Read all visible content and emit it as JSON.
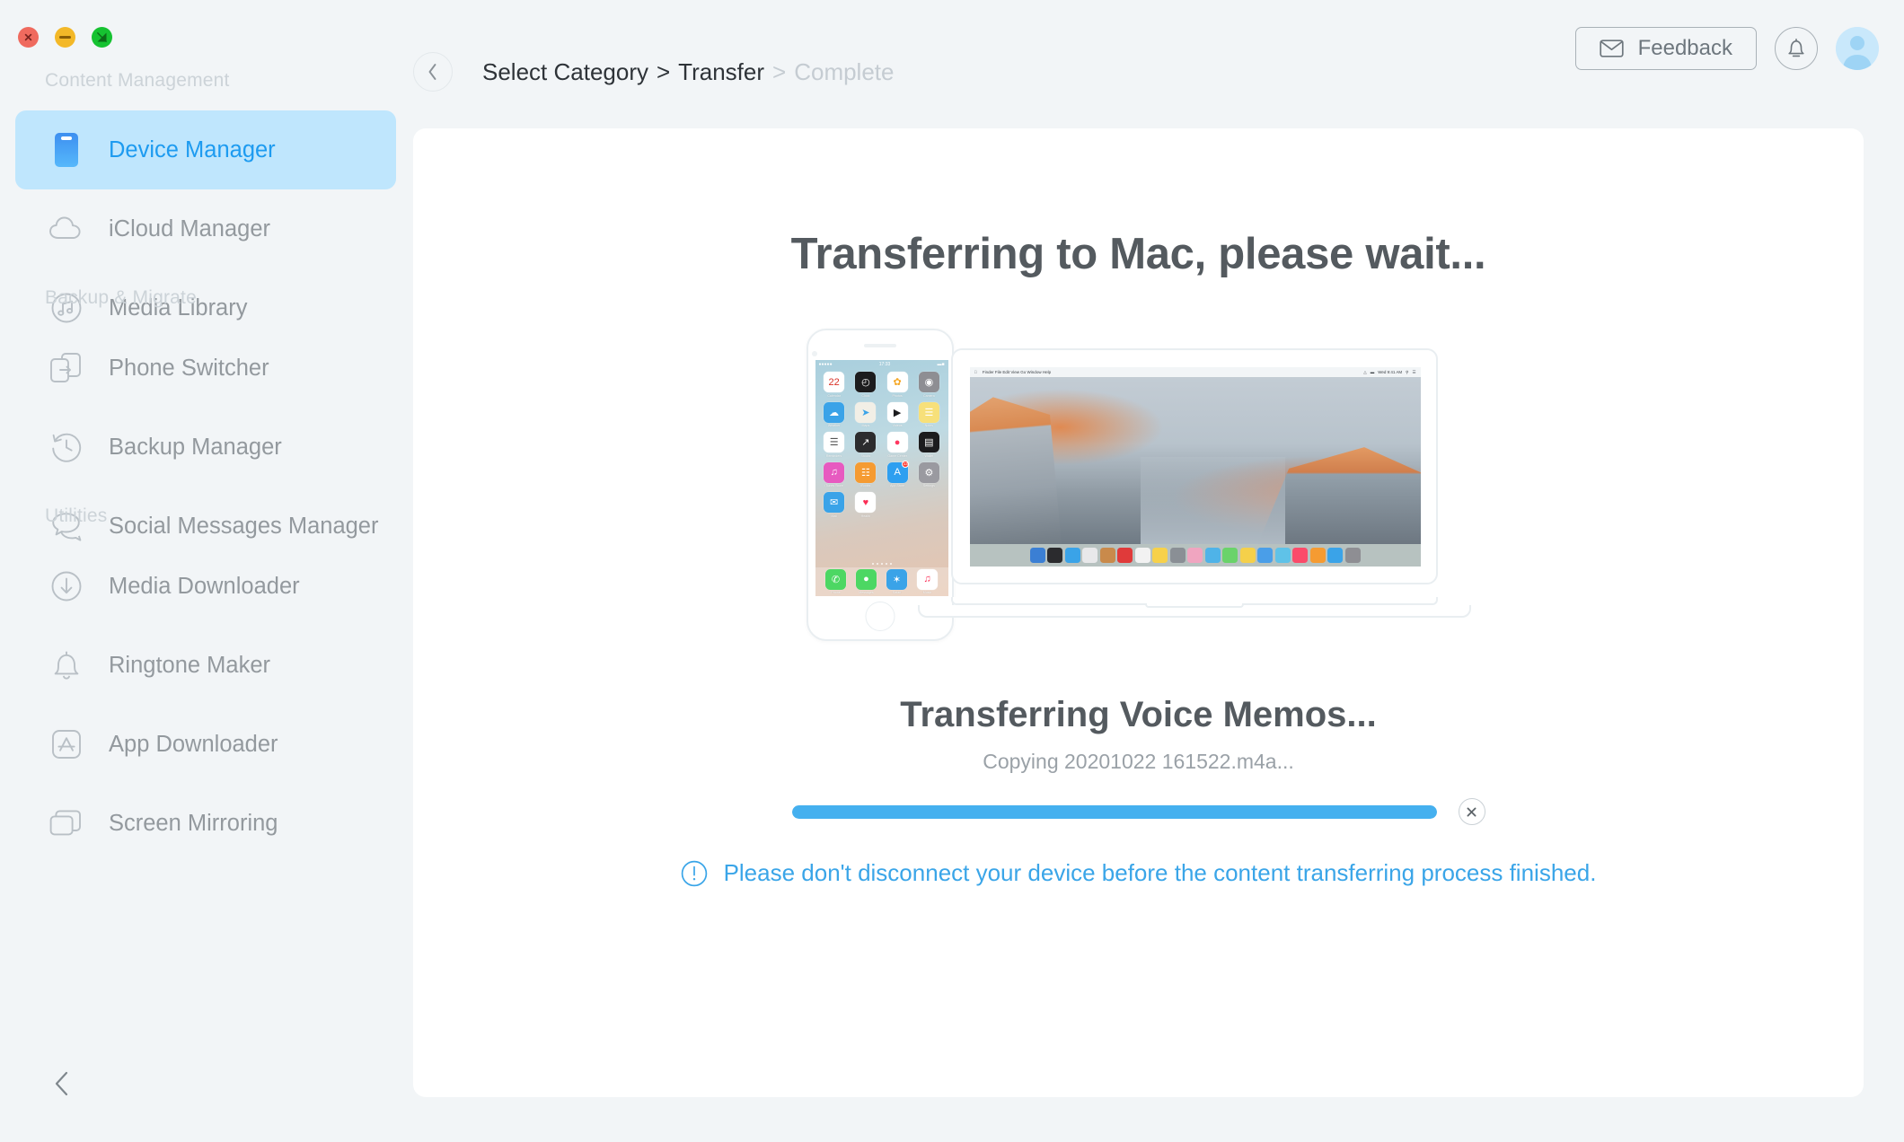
{
  "window": {
    "traffic_lights": [
      "close",
      "minimize",
      "maximize"
    ]
  },
  "sidebar": {
    "sections": [
      {
        "title": "Content Management",
        "items": [
          {
            "label": "Device Manager",
            "icon": "device-phone-icon",
            "active": true
          },
          {
            "label": "iCloud Manager",
            "icon": "cloud-icon",
            "active": false
          },
          {
            "label": "Media Library",
            "icon": "music-note-circle-icon",
            "active": false
          }
        ]
      },
      {
        "title": "Backup & Migrate",
        "items": [
          {
            "label": "Phone Switcher",
            "icon": "phone-transfer-icon",
            "active": false
          },
          {
            "label": "Backup Manager",
            "icon": "history-clock-icon",
            "active": false
          },
          {
            "label": "Social Messages Manager",
            "icon": "chat-bubbles-icon",
            "active": false
          }
        ]
      },
      {
        "title": "Utilities",
        "items": [
          {
            "label": "Media Downloader",
            "icon": "download-circle-icon",
            "active": false
          },
          {
            "label": "Ringtone Maker",
            "icon": "bell-icon",
            "active": false
          },
          {
            "label": "App Downloader",
            "icon": "app-store-icon",
            "active": false
          },
          {
            "label": "Screen Mirroring",
            "icon": "screens-stack-icon",
            "active": false
          }
        ]
      }
    ],
    "collapse_icon": "chevron-left-icon"
  },
  "header": {
    "back_icon": "chevron-left-icon",
    "breadcrumb": [
      {
        "label": "Select Category",
        "active": true
      },
      {
        "label": "Transfer",
        "active": true
      },
      {
        "label": "Complete",
        "active": false
      }
    ],
    "separator": ">",
    "feedback_label": "Feedback",
    "feedback_icon": "envelope-icon",
    "notification_icon": "bell-icon",
    "avatar_icon": "user-avatar-icon"
  },
  "main": {
    "title": "Transferring to Mac, please wait...",
    "illustration": {
      "phone": {
        "name": "iphone-illustration",
        "status_time": "17:33",
        "status_left": "●●●●●",
        "apps": [
          {
            "name": "Calendar",
            "glyph": "22",
            "bg": "#ffffff",
            "fg": "#d93025"
          },
          {
            "name": "Clock",
            "glyph": "◴",
            "bg": "#1c1c1e",
            "fg": "#ffffff"
          },
          {
            "name": "Photos",
            "glyph": "✿",
            "bg": "#ffffff",
            "fg": "#f5a623"
          },
          {
            "name": "Camera",
            "glyph": "◉",
            "bg": "#8e8e93",
            "fg": "#ffffff"
          },
          {
            "name": "Weather",
            "glyph": "☁",
            "bg": "#3aa3e8",
            "fg": "#ffffff"
          },
          {
            "name": "Maps",
            "glyph": "➤",
            "bg": "#f2efe6",
            "fg": "#3aa3e8"
          },
          {
            "name": "Videos",
            "glyph": "▶",
            "bg": "#ffffff",
            "fg": "#1c1c1e"
          },
          {
            "name": "Notes",
            "glyph": "☰",
            "bg": "#f7e07a",
            "fg": "#ffffff"
          },
          {
            "name": "Reminders",
            "glyph": "☰",
            "bg": "#ffffff",
            "fg": "#555555"
          },
          {
            "name": "Stocks",
            "glyph": "↗",
            "bg": "#2c2c2e",
            "fg": "#ffffff"
          },
          {
            "name": "Game Center",
            "glyph": "●",
            "bg": "#ffffff",
            "fg": "#ff375f"
          },
          {
            "name": "Wallet",
            "glyph": "▤",
            "bg": "#1c1c1e",
            "fg": "#ffffff"
          },
          {
            "name": "iTunes Store",
            "glyph": "♫",
            "bg": "#e75ac0",
            "fg": "#ffffff"
          },
          {
            "name": "iBooks",
            "glyph": "☷",
            "bg": "#f59b32",
            "fg": "#ffffff"
          },
          {
            "name": "App Store",
            "glyph": "A",
            "bg": "#2e9ff0",
            "fg": "#ffffff",
            "badge": "13"
          },
          {
            "name": "Settings",
            "glyph": "⚙",
            "bg": "#9a9aa0",
            "fg": "#ffffff"
          },
          {
            "name": "Mail",
            "glyph": "✉",
            "bg": "#3aa3e8",
            "fg": "#ffffff"
          },
          {
            "name": "Health",
            "glyph": "♥",
            "bg": "#ffffff",
            "fg": "#fb2d55"
          }
        ],
        "dock": [
          {
            "name": "Phone",
            "glyph": "✆",
            "bg": "#4cd763",
            "fg": "#ffffff"
          },
          {
            "name": "Messages",
            "glyph": "●",
            "bg": "#4cd763",
            "fg": "#ffffff"
          },
          {
            "name": "Safari",
            "glyph": "✶",
            "bg": "#3aa3e8",
            "fg": "#ffffff"
          },
          {
            "name": "Music",
            "glyph": "♫",
            "bg": "#ffffff",
            "fg": "#fb2d55"
          }
        ]
      },
      "laptop": {
        "name": "macbook-illustration",
        "menubar_left": [
          "Finder",
          "File",
          "Edit",
          "View",
          "Go",
          "Window",
          "Help"
        ],
        "menubar_right": "Wed 9:41 AM",
        "wallpaper": "el-capitan-yosemite",
        "dock_count": 19
      }
    },
    "transfer": {
      "status_title": "Transferring Voice Memos...",
      "copying_text": "Copying 20201022 161522.m4a...",
      "progress_percent": 100,
      "cancel_icon": "close-x-icon"
    },
    "notice": {
      "icon": "exclamation-circle-icon",
      "text": "Please don't disconnect your device before the content transferring process finished."
    }
  },
  "colors": {
    "accent": "#3aa5e8",
    "progress_fill": "#45b0ef",
    "sidebar_bg": "#f2f5f7",
    "card_bg": "#ffffff",
    "active_item_bg": "#bfe6fd",
    "active_item_text": "#1d9bf0",
    "muted_text": "#93999e",
    "section_title": "#ccd3d8"
  }
}
